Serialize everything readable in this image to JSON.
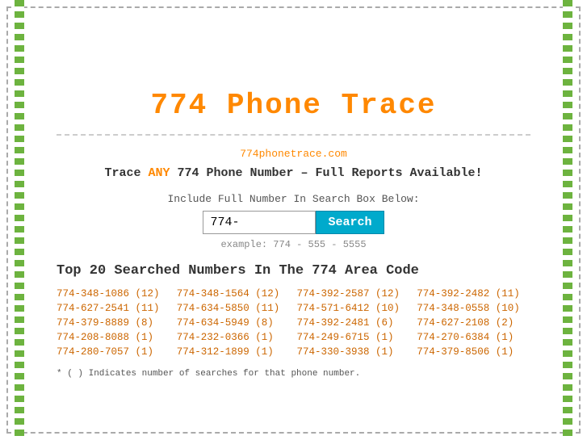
{
  "header": {
    "title": "774 Phone Trace",
    "dashed_border": true
  },
  "site": {
    "url": "774phonetrace.com",
    "tagline_prefix": "Trace ",
    "tagline_any": "ANY",
    "tagline_suffix": " 774 Phone Number – Full Reports Available!"
  },
  "search": {
    "label": "Include Full Number In Search Box Below:",
    "input_value": "774-",
    "button_label": "Search",
    "example": "example: 774 - 555 - 5555"
  },
  "top_numbers": {
    "section_title": "Top 20 Searched Numbers In The 774 Area Code",
    "numbers": [
      "774-348-1086 (12)",
      "774-348-1564 (12)",
      "774-392-2587 (12)",
      "774-392-2482 (11)",
      "774-627-2541 (11)",
      "774-634-5850 (11)",
      "774-571-6412 (10)",
      "774-348-0558 (10)",
      "774-379-8889 (8)",
      "774-634-5949 (8)",
      "774-392-2481 (6)",
      "774-627-2108 (2)",
      "774-208-8088 (1)",
      "774-232-0366 (1)",
      "774-249-6715 (1)",
      "774-270-6384 (1)",
      "774-280-7057 (1)",
      "774-312-1899 (1)",
      "774-330-3938 (1)",
      "774-379-8506 (1)"
    ],
    "footnote": "* ( ) Indicates number of searches for that phone number."
  }
}
